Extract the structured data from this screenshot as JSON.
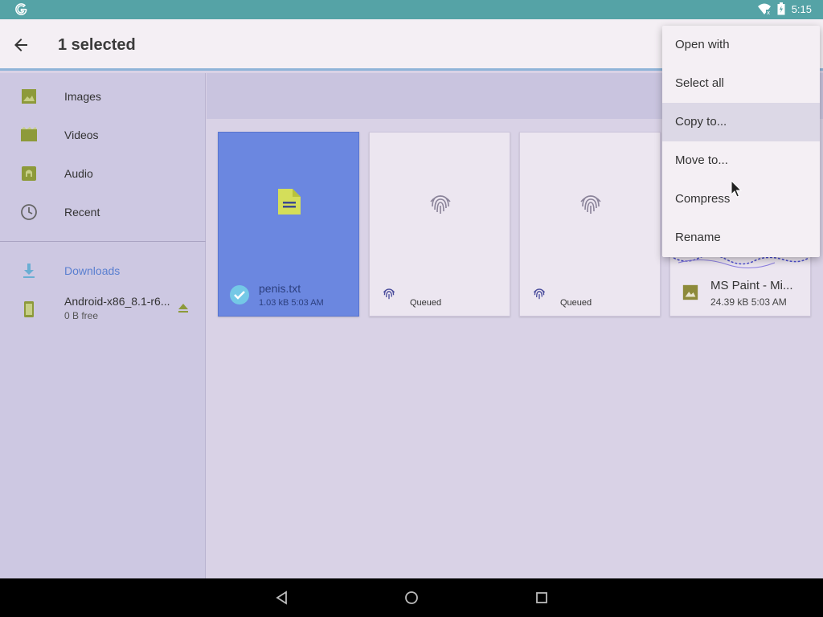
{
  "status_bar": {
    "time": "5:15",
    "icons": [
      "google-g-icon",
      "wifi-icon",
      "battery-icon"
    ]
  },
  "app_bar": {
    "title": "1 selected",
    "back_icon": "arrow-back-icon"
  },
  "sidebar": {
    "items": [
      {
        "label": "Images",
        "icon": "image-icon"
      },
      {
        "label": "Videos",
        "icon": "video-icon"
      },
      {
        "label": "Audio",
        "icon": "audio-icon"
      },
      {
        "label": "Recent",
        "icon": "clock-icon"
      },
      {
        "label": "Downloads",
        "icon": "download-icon"
      },
      {
        "label": "Android-x86_8.1-r6...",
        "sublabel": "0 B free",
        "icon": "device-icon",
        "action_icon": "eject-icon"
      }
    ]
  },
  "files": [
    {
      "name": "penis.txt",
      "meta": "1.03 kB 5:03 AM",
      "selected": true,
      "icon": "text-file-icon",
      "status_icon": "check-circle-icon"
    },
    {
      "status": "Queued",
      "icon": "fingerprint-icon"
    },
    {
      "status": "Queued",
      "icon": "fingerprint-icon"
    },
    {
      "name": "MS Paint - Mi...",
      "meta": "24.39 kB 5:03 AM",
      "icon": "image-file-icon"
    }
  ],
  "context_menu": {
    "items": [
      "Open with",
      "Select all",
      "Copy to...",
      "Move to...",
      "Compress",
      "Rename"
    ],
    "highlighted_index": 2
  },
  "nav_bar": {
    "icons": [
      "back-triangle-icon",
      "home-circle-icon",
      "recents-square-icon"
    ]
  },
  "colors": {
    "status_bar": "#55a3a6",
    "selected_card": "#6b87e0",
    "sidebar_bg": "#cdc8e2",
    "main_bg": "#d9d2e6",
    "downloads_accent": "#5a7fd0"
  }
}
